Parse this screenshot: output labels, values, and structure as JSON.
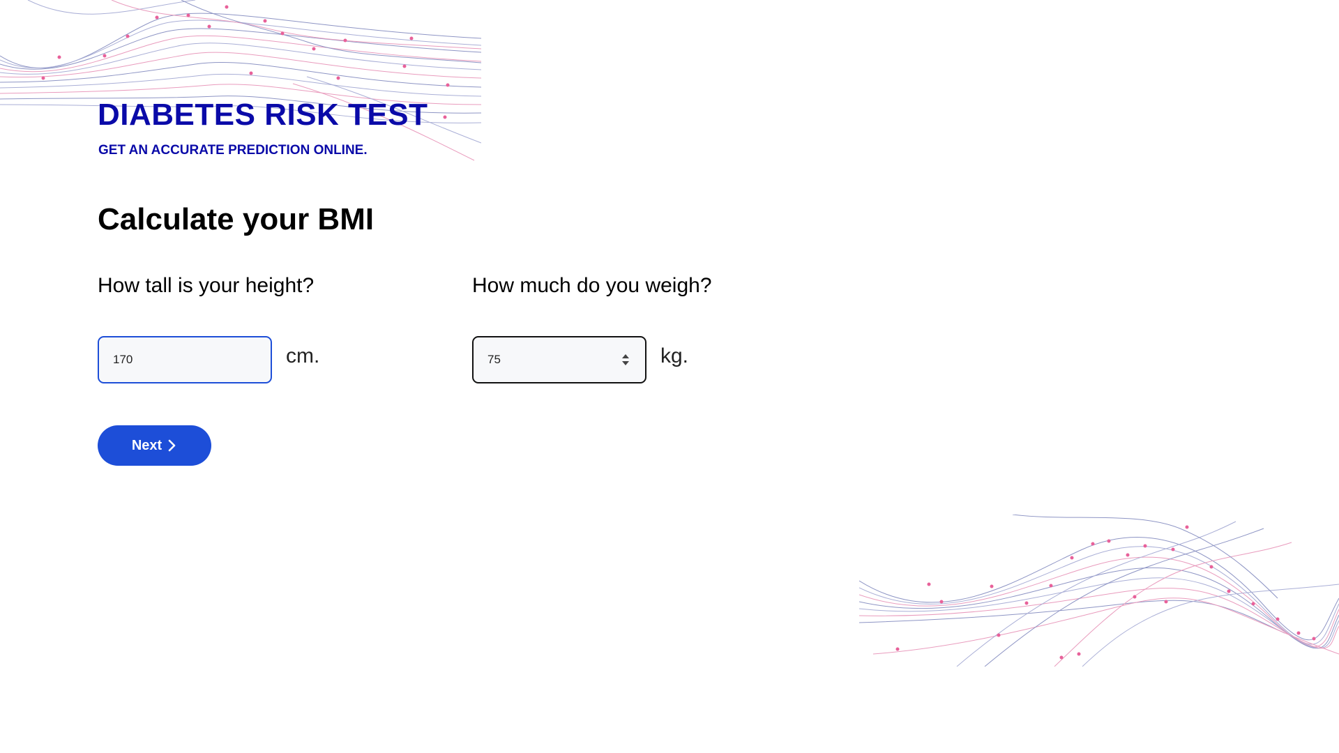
{
  "header": {
    "title": "DIABETES RISK TEST",
    "subtitle": "GET AN ACCURATE PREDICTION ONLINE."
  },
  "section": {
    "title": "Calculate your BMI"
  },
  "height": {
    "question": "How tall is your height?",
    "value": "170",
    "unit": "cm."
  },
  "weight": {
    "question": "How much do you weigh?",
    "value": "75",
    "unit": "kg."
  },
  "next_button": {
    "label": "Next",
    "icon": "chevron-right-icon"
  },
  "colors": {
    "brand": "#0a0aa8",
    "button": "#1d4ed8",
    "wave_line": "#8d94c4",
    "wave_dot": "#e8619a"
  }
}
